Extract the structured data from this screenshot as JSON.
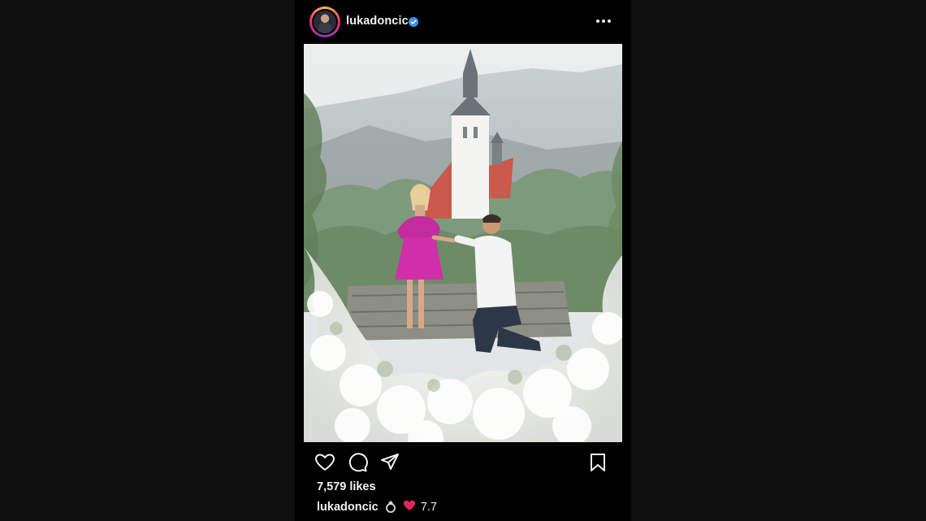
{
  "post": {
    "username": "lukadoncic",
    "verified": true,
    "likes_text": "7,579 likes",
    "caption": {
      "username": "lukadoncic",
      "emojis": [
        "ring-emoji",
        "red-heart-emoji"
      ],
      "text": "7.7"
    }
  },
  "icons": {
    "more": "more-options-icon",
    "like": "heart-icon",
    "comment": "comment-icon",
    "share": "share-icon",
    "save": "bookmark-icon"
  },
  "colors": {
    "background": "#0f0f0f",
    "post_background": "#000000",
    "text": "#f2f2f2",
    "verified_blue": "#3897f0",
    "heart_red": "#e0245e"
  }
}
